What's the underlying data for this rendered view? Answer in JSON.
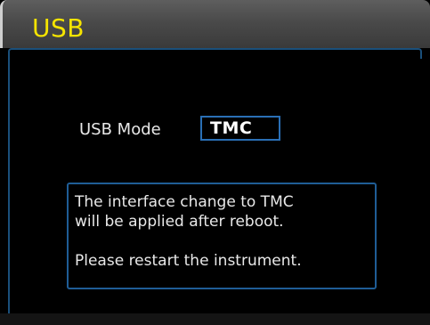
{
  "window": {
    "title": "USB"
  },
  "usb_mode": {
    "label": "USB Mode",
    "value": "TMC"
  },
  "message": {
    "line1": "The interface change to TMC",
    "line2": "will be applied after reboot.",
    "line3": "Please restart the instrument."
  },
  "colors": {
    "title_text": "#f5e400",
    "accent_border": "#2a6fb5",
    "background": "#000000"
  }
}
